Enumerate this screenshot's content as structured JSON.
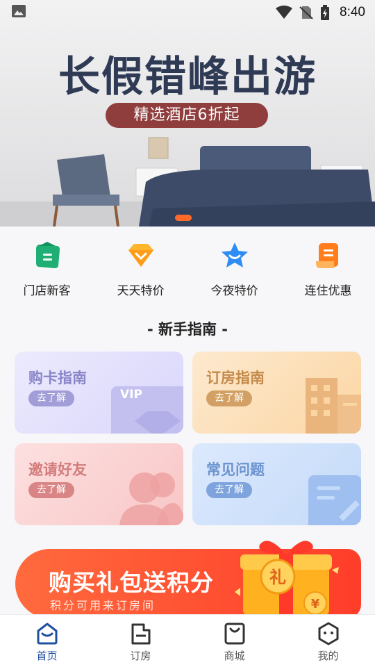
{
  "status_bar": {
    "time": "8:40"
  },
  "banner": {
    "title": "长假错峰出游",
    "subtitle": "精选酒店6折起"
  },
  "quick_menu": [
    {
      "label": "门店新客",
      "icon": "store-new-customer-icon",
      "color": "#20b67a"
    },
    {
      "label": "天天特价",
      "icon": "daily-deal-icon",
      "color": "#ffa51f"
    },
    {
      "label": "今夜特价",
      "icon": "tonight-deal-icon",
      "color": "#2f8cf5"
    },
    {
      "label": "连住优惠",
      "icon": "stay-discount-icon",
      "color": "#ff7d1a"
    }
  ],
  "guide": {
    "title": "- 新手指南 -",
    "cards": [
      {
        "title": "购卡指南",
        "button": "去了解",
        "badge": "VIP"
      },
      {
        "title": "订房指南",
        "button": "去了解"
      },
      {
        "title": "邀请好友",
        "button": "去了解"
      },
      {
        "title": "常见问题",
        "button": "去了解"
      }
    ]
  },
  "promo": {
    "title": "购买礼包送积分",
    "subtitle": "积分可用来订房间",
    "gift_label": "礼",
    "coin_label": "¥"
  },
  "tabs": [
    {
      "label": "首页",
      "icon": "home-icon",
      "active": true
    },
    {
      "label": "订房",
      "icon": "booking-icon",
      "active": false
    },
    {
      "label": "商城",
      "icon": "shop-icon",
      "active": false
    },
    {
      "label": "我的",
      "icon": "profile-icon",
      "active": false
    }
  ],
  "colors": {
    "accent": "#1f4f9f",
    "promo": "#ff4a2e",
    "banner_dot": "#ff6a2b"
  }
}
